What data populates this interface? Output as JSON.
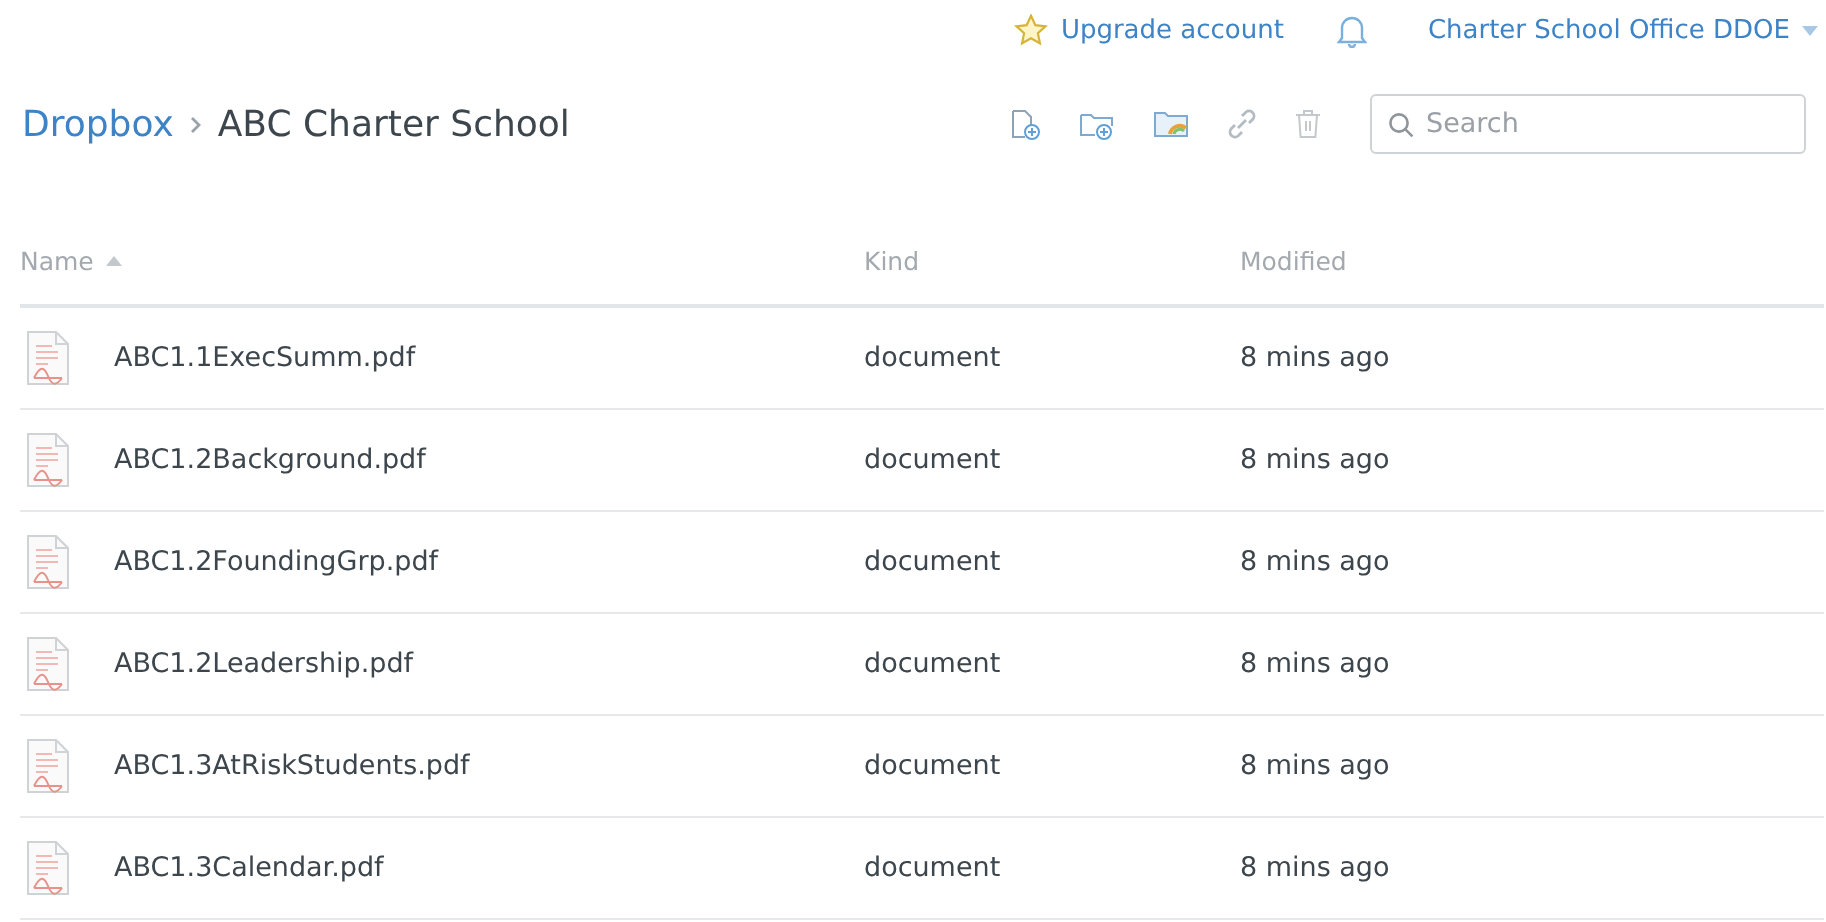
{
  "top_bar": {
    "upgrade": "Upgrade account",
    "account": "Charter School Office DDOE"
  },
  "breadcrumb": [
    {
      "label": "Dropbox",
      "kind": "link"
    },
    {
      "label": "ABC Charter School",
      "kind": "current"
    }
  ],
  "toolbar": {
    "search": {
      "placeholder": "Search"
    }
  },
  "table": {
    "columns": [
      {
        "label": "Name",
        "sorted": true
      },
      {
        "label": "Kind",
        "sorted": false
      },
      {
        "label": "Modified",
        "sorted": false
      }
    ],
    "rows": [
      {
        "name": "ABC1.1ExecSumm.pdf",
        "kind": "document",
        "modified": "8 mins ago"
      },
      {
        "name": "ABC1.2Background.pdf",
        "kind": "document",
        "modified": "8 mins ago"
      },
      {
        "name": "ABC1.2FoundingGrp.pdf",
        "kind": "document",
        "modified": "8 mins ago"
      },
      {
        "name": "ABC1.2Leadership.pdf",
        "kind": "document",
        "modified": "8 mins ago"
      },
      {
        "name": "ABC1.3AtRiskStudents.pdf",
        "kind": "document",
        "modified": "8 mins ago"
      },
      {
        "name": "ABC1.3Calendar.pdf",
        "kind": "document",
        "modified": "8 mins ago"
      }
    ]
  }
}
